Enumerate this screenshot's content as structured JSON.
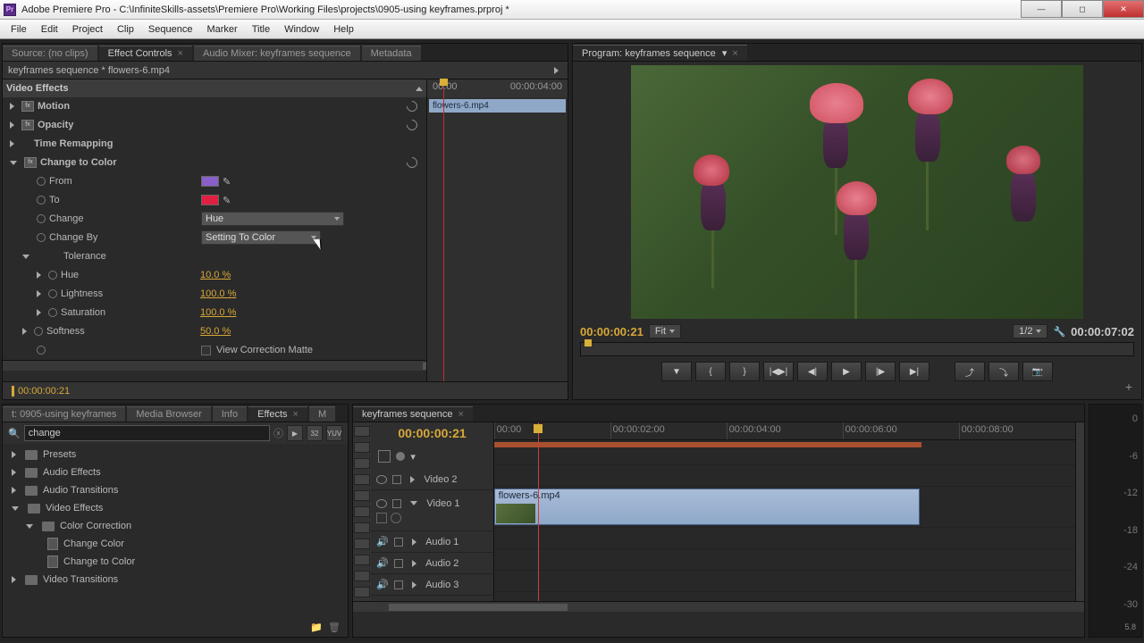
{
  "window": {
    "title": "Adobe Premiere Pro - C:\\InfiniteSkills-assets\\Premiere Pro\\Working Files\\projects\\0905-using keyframes.prproj *",
    "app_abbrev": "Pr"
  },
  "menu": [
    "File",
    "Edit",
    "Project",
    "Clip",
    "Sequence",
    "Marker",
    "Title",
    "Window",
    "Help"
  ],
  "source_panel": {
    "tabs": [
      "Source: (no clips)",
      "Effect Controls",
      "Audio Mixer: keyframes sequence",
      "Metadata"
    ],
    "active": 1
  },
  "effect_controls": {
    "header": "keyframes sequence * flowers-6.mp4",
    "ruler_end": "00:00:04:00",
    "ruler_start": "00:00",
    "clip_name": "flowers-6.mp4",
    "section": "Video Effects",
    "effects": [
      {
        "name": "Motion",
        "reset": true
      },
      {
        "name": "Opacity",
        "reset": true
      },
      {
        "name": "Time Remapping",
        "reset": false
      }
    ],
    "change_to_color": {
      "label": "Change to Color",
      "from_label": "From",
      "from_color": "#8860c8",
      "to_label": "To",
      "to_color": "#e02040",
      "change_label": "Change",
      "change_value": "Hue",
      "changeby_label": "Change By",
      "changeby_value": "Setting To Color",
      "tolerance_label": "Tolerance",
      "hue_label": "Hue",
      "hue_value": "10.0 %",
      "lightness_label": "Lightness",
      "lightness_value": "100.0 %",
      "saturation_label": "Saturation",
      "saturation_value": "100.0 %",
      "softness_label": "Softness",
      "softness_value": "50.0 %",
      "matte_label": "View Correction Matte"
    },
    "timecode": "00:00:00:21"
  },
  "program": {
    "tab": "Program: keyframes sequence",
    "timecode_left": "00:00:00:21",
    "fit": "Fit",
    "zoom": "1/2",
    "timecode_right": "00:00:07:02"
  },
  "project_panel": {
    "tabs": [
      "t: 0905-using keyframes",
      "Media Browser",
      "Info",
      "Effects",
      "M"
    ],
    "active": 3,
    "search": "change",
    "tree": [
      {
        "label": "Presets",
        "type": "folder",
        "depth": 0,
        "open": false
      },
      {
        "label": "Audio Effects",
        "type": "folder",
        "depth": 0,
        "open": false
      },
      {
        "label": "Audio Transitions",
        "type": "folder",
        "depth": 0,
        "open": false
      },
      {
        "label": "Video Effects",
        "type": "folder",
        "depth": 0,
        "open": true
      },
      {
        "label": "Color Correction",
        "type": "folder",
        "depth": 1,
        "open": true
      },
      {
        "label": "Change Color",
        "type": "fx",
        "depth": 2
      },
      {
        "label": "Change to Color",
        "type": "fx",
        "depth": 2
      },
      {
        "label": "Video Transitions",
        "type": "folder",
        "depth": 0,
        "open": false
      }
    ]
  },
  "timeline": {
    "tab": "keyframes sequence",
    "timecode": "00:00:00:21",
    "ruler": [
      "00:00",
      "00:00:02:00",
      "00:00:04:00",
      "00:00:06:00",
      "00:00:08:00"
    ],
    "tracks": {
      "v2": "Video 2",
      "v1": "Video 1",
      "a1": "Audio 1",
      "a2": "Audio 2",
      "a3": "Audio 3"
    },
    "clip": "flowers-6.mp4"
  },
  "meter": {
    "labels": [
      "0",
      "-6",
      "-12",
      "-18",
      "-24",
      "-30"
    ],
    "readout": "5.8"
  }
}
